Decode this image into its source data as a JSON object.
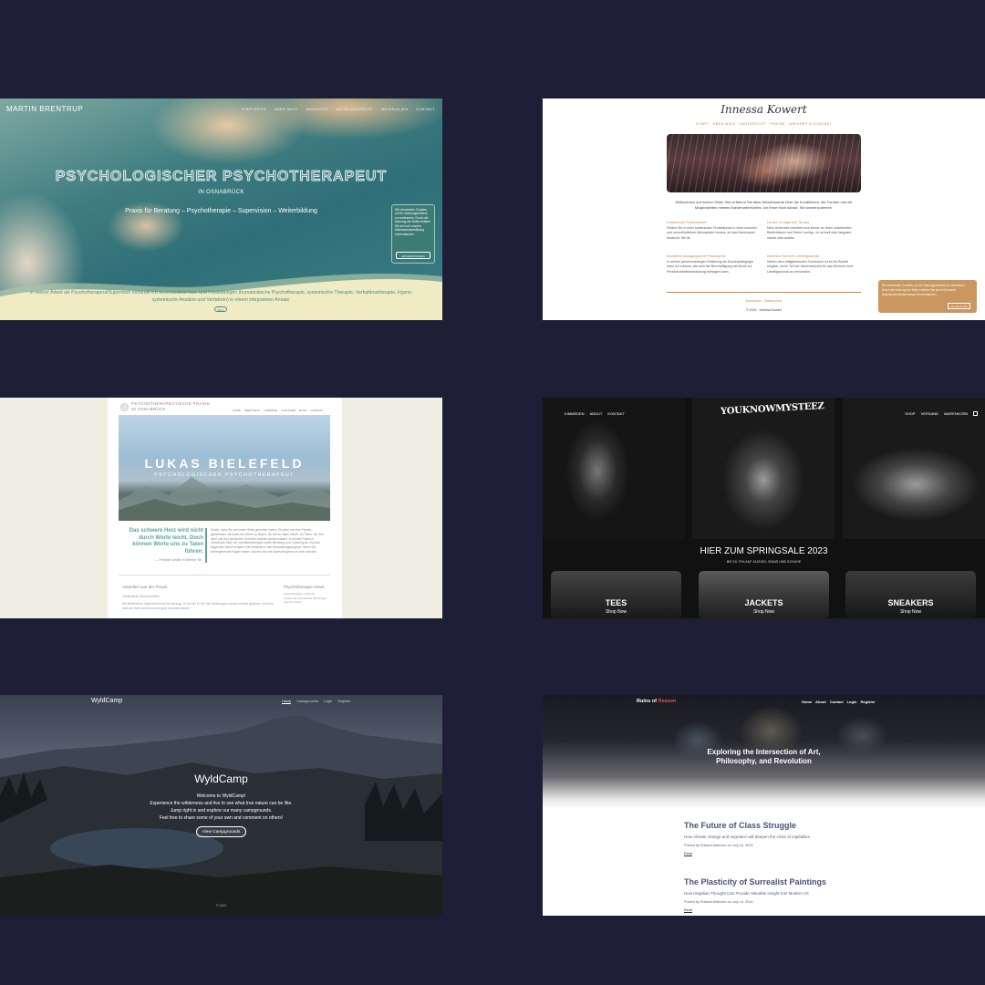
{
  "tile1": {
    "brand": "MARTIN BRENTRUP",
    "nav": [
      "STARTSEITE",
      "ÜBER MICH",
      "ANGEBOTE",
      "MEINE ANGEBOTE",
      "MATERIALIEN",
      "KONTAKT"
    ],
    "hero_title": "PSYCHOLOGISCHER PSYCHOTHERAPEUT",
    "hero_subtitle": "IN OSNABRÜCK",
    "hero_line": "Praxis für Beratung – Psychotherapie – Supervision – Weiterbildung",
    "cookie_text": "Wir verwenden Cookies, um Ihr Nutzungserlebnis zu verbessern. Durch die Nutzung der Seite erklären Sie sich mit unserer Datenschutzerklärung einverstanden.",
    "cookie_button": "EINVERSTANDEN",
    "intro": "In meiner Arbeit als Psychotherapeut/Supervisor verbinde ich verschiedene Aus- und Fortbildungen (humanistische Psychotherapie, systemische Therapie, Verhaltenstherapie, Hypno-systemische Ansätze und Verfahren) in einem integrativen Ansatz.",
    "more": "Mehr"
  },
  "tile2": {
    "logo": "Innessa Kowert",
    "menu": "START · ÜBER MICH · UNTERRICHT · PREISE · ANFAHRT & KONTAKT",
    "welcome": "Willkommen auf meiner Seite! Hier erfahren Sie alles Wissenswerte über die Konditionen, die Formen und die Möglichkeiten meines Klavierunterrichtes. Ich freue mich darauf, Sie kennenzulernen.",
    "features": [
      {
        "title": "Kostenlose Probestunde",
        "text": "Finden Sie in einer kostenlosen Probestunde in einer lockeren und unverbindlichen Atmosphäre heraus, ob das Klavierspiel etwas für Sie ist."
      },
      {
        "title": "Lernen in eigenem Tempo",
        "text": "Mein Unterricht orientiert sich immer an Ihren individuellen Bedürfnissen und Ihrem Lerntyp, ob schnell oder langsam, visuell oder auditiv."
      },
      {
        "title": "Bewährte pädagogische Philosophie",
        "text": "In meiner jahrzehntelangen Erfahrung als Klavierpädagogin habe ich erkannt, wie sehr die Beschäftigung mit Musik zur Persönlichkeitsentwicklung beitragen kann."
      },
      {
        "title": "Nehmen Sie Ihre Lieblingsmusik",
        "text": "Neben dem obligatorischen Curriculum ist es bei Bedarf möglich, einen Teil der Unterrichtszeit für das Erlernen Ihrer Lieblingsmusik zu verwenden."
      }
    ],
    "links": "Impressum · Datenschutz",
    "copyright": "© 2024 · Innessa Kowert",
    "cookie_text": "Wir verwenden Cookies, um Ihr Nutzungserlebnis zu verbessern. Durch die Nutzung der Seite erklären Sie sich mit unserer Datenschutzbestimmungen einverstanden.",
    "cookie_button": "ALLES KLAR"
  },
  "tile3": {
    "brand_line1": "PSYCHOTHERAPEUTISCHE PRAXIS",
    "brand_line2": "IN OSNABRÜCK",
    "nav": [
      "HOME",
      "ÜBER MICH",
      "THERAPIE",
      "AUSLÖSER",
      "BLOG",
      "KONTAKT"
    ],
    "hero_title": "LUKAS BIELEFELD",
    "hero_subtitle": "PSYCHOLOGISCHER PSYCHOTHERAPEUT",
    "quote": "Das schwere Herz wird nicht durch Worte leicht. Doch können Worte uns zu Taten führen.",
    "quote_source": "— Friedrich Schiller in Wilhelm Tell",
    "paragraph": "Schön, dass Sie auf meine Seite gefunden haben. Es wäre mir eine Freude, gemeinsam mit Ihnen die Worte zu finden, die Sie zu Taten führen. Zu Taten, die Ihre Herz und den seelischen Schmerz leichter werden lassen. In meiner Praxis in Osnabrück biete ich Verhaltenstherapie sowie Beratung und Coaching an. Auf den folgenden Seiten erhalten Sie Einblicke in das Behandlungsangebot. Wenn Sie weitergehende Fragen haben, können Sie sich jederzeit gerne an mich wenden.",
    "news_heading": "Aktuelles aus der Praxis",
    "news_subheading": "Geänderte Sprechzeiten",
    "news_text": "Die telefonische Sprechzeit ist ab Donnerstag, 10 Uhr bis 11 Uhr. Wir Änderungen werden zeitnah gegeben. Ich freue mich auf Ihren Anruf und eine gute Zusammenarbeit.",
    "side_heading": "Psychotherapie-News",
    "side_text": "Psychotherapie: Leitlinien, Forschung und aktuelle Meldungen aus der Praxis."
  },
  "tile4": {
    "nav_left": [
      "KIMMEDEN",
      "ABOUT",
      "KONTAKT"
    ],
    "logo": "YOUKNOWMYSTEEZ",
    "nav_right": [
      "SHOP",
      "VERSAND",
      "WARENKORB"
    ],
    "sale_title": "HIER ZUM SPRINGSALE 2023",
    "sale_subtitle": "BIS ZU 70% AUF JACKEN, JEANS UND SCHUHE",
    "categories": [
      {
        "name": "TEES",
        "cta": "Shop Now"
      },
      {
        "name": "JACKETS",
        "cta": "Shop Now"
      },
      {
        "name": "SNEAKERS",
        "cta": "Shop Now"
      }
    ]
  },
  "tile5": {
    "brand": "WyldCamp",
    "nav": [
      "Home",
      "Campgrounds",
      "Login",
      "Register"
    ],
    "title": "WyldCamp",
    "lines": [
      "Welcome to WyldCamp!",
      "Experience the wilderness and live to see what true nature can be like.",
      "Jump right in and explore our many campgrounds.",
      "Feel free to share some of your own and comment on others!"
    ],
    "button": "View Campgrounds",
    "copyright": "© 2022"
  },
  "tile6": {
    "brand_a": "Ruins of ",
    "brand_b": "Reason",
    "nav": [
      "Home",
      "About",
      "Contact",
      "Login",
      "Register"
    ],
    "hero_line1": "Exploring the Intersection of Art,",
    "hero_line2": "Philosophy, and Revolution",
    "posts": [
      {
        "title": "The Future of Class Struggle",
        "subtitle": "How climate change and migration will deepen the crisis of capitalism",
        "meta": "Posted by Edward Alderson on July 10, 2024",
        "read": "Read"
      },
      {
        "title": "The Plasticity of Surrealist Paintings",
        "subtitle": "How Hegelian Thought Can Provide Valuable Insight Into Modern Art",
        "meta": "Posted by Edward Alderson on July 10, 2024",
        "read": "Read"
      }
    ]
  }
}
